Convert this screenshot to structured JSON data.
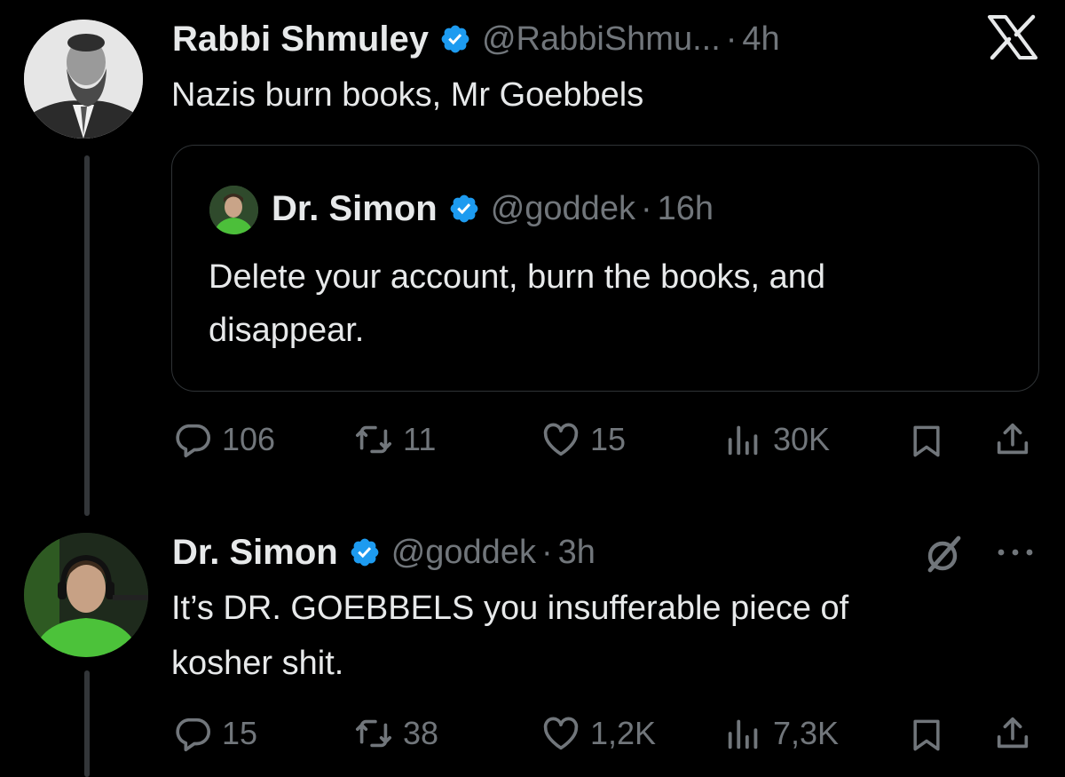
{
  "tweet1": {
    "author_name": "Rabbi Shmuley",
    "handle": "@RabbiShmu...",
    "separator": "·",
    "time": "4h",
    "text": "Nazis burn books, Mr Goebbels",
    "quote": {
      "author_name": "Dr. Simon",
      "handle": "@goddek",
      "separator": "·",
      "time": "16h",
      "text_line1": "Delete your account, burn the books, and",
      "text_line2": "disappear."
    },
    "actions": {
      "replies": "106",
      "reposts": "11",
      "likes": "15",
      "views": "30K"
    }
  },
  "tweet2": {
    "author_name": "Dr. Simon",
    "handle": "@goddek",
    "separator": "·",
    "time": "3h",
    "text_line1": "It’s DR. GOEBBELS you insufferable piece of",
    "text_line2": "kosher shit.",
    "actions": {
      "replies": "15",
      "reposts": "38",
      "likes": "1,2K",
      "views": "7,3K"
    }
  },
  "colors": {
    "background": "#000000",
    "text": "#e7e9ea",
    "muted": "#71767b",
    "verified": "#1d9bf0",
    "border": "#2f3336"
  },
  "icons": [
    "x-logo-icon",
    "verified-badge-icon",
    "reply-icon",
    "repost-icon",
    "like-icon",
    "views-icon",
    "bookmark-icon",
    "share-icon",
    "grok-icon",
    "more-icon"
  ]
}
